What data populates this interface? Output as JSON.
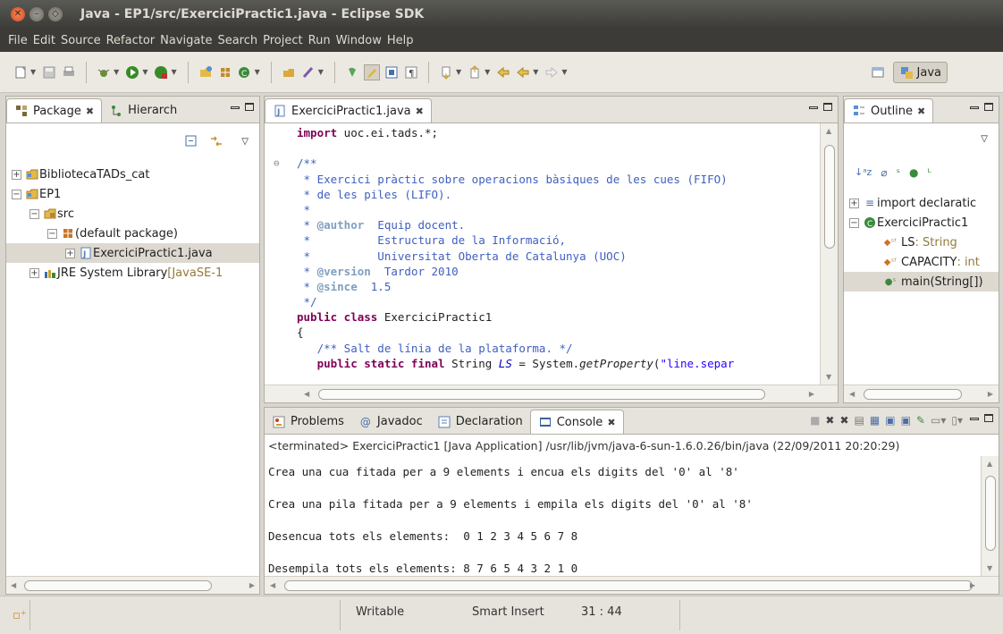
{
  "window": {
    "title": "Java - EP1/src/ExerciciPractic1.java - Eclipse SDK",
    "close_icon": "✕",
    "min_icon": "–",
    "max_icon": "◇"
  },
  "menu": [
    "File",
    "Edit",
    "Source",
    "Refactor",
    "Navigate",
    "Search",
    "Project",
    "Run",
    "Window",
    "Help"
  ],
  "perspective": {
    "label": "Java"
  },
  "package_explorer": {
    "tabs": [
      {
        "label": "Package"
      },
      {
        "label": "Hierarch"
      }
    ],
    "tree": [
      {
        "expander": "+",
        "label": "BibliotecaTADs_cat",
        "suffix": ""
      },
      {
        "expander": "−",
        "label": "EP1",
        "suffix": ""
      },
      {
        "expander": "−",
        "label": "src",
        "suffix": ""
      },
      {
        "expander": "−",
        "label": "(default package)",
        "suffix": ""
      },
      {
        "expander": "+",
        "label": "ExerciciPractic1.java",
        "suffix": ""
      },
      {
        "expander": "+",
        "label": "JRE System Library ",
        "suffix": "[JavaSE-1"
      }
    ]
  },
  "editor": {
    "tab_label": "ExerciciPractic1.java",
    "lines": {
      "l1_kw": "import",
      "l1_rest": " uoc.ei.tads.*;",
      "l3": "/**",
      "l4": " * Exercici pràctic sobre operacions bàsiques de les cues (FIFO)",
      "l5": " * de les piles (LIFO).",
      "l6": " *",
      "l7_pre": " * ",
      "l7_tag": "@author",
      "l7_rest": "  Equip docent.",
      "l8": " *          Estructura de la Informació,",
      "l9": " *          Universitat Oberta de Catalunya (UOC)",
      "l10_pre": " * ",
      "l10_tag": "@version",
      "l10_rest": "  Tardor 2010",
      "l11_pre": " * ",
      "l11_tag": "@since",
      "l11_rest": "  1.5",
      "l12": " */",
      "l13_kw": "public class",
      "l13_rest": " ExerciciPractic1",
      "l14": "{",
      "l15": "   /** Salt de línia de la plataforma. */",
      "l16_kw": "   public static final",
      "l16_a": " String ",
      "l16_field": "LS",
      "l16_b": " = System.",
      "l16_method": "getProperty",
      "l16_c": "(",
      "l16_str": "\"line.separ"
    }
  },
  "outline": {
    "tab_label": "Outline",
    "items": [
      {
        "expander": "+",
        "label": "import declaratic",
        "type": ""
      },
      {
        "expander": "−",
        "label": "ExerciciPractic1",
        "type": ""
      },
      {
        "expander": "",
        "label": "LS",
        "type": " : String"
      },
      {
        "expander": "",
        "label": "CAPACITY",
        "type": " : int"
      },
      {
        "expander": "",
        "label": "main(String[])",
        "type": ""
      }
    ]
  },
  "console": {
    "tabs": [
      {
        "label": "Problems"
      },
      {
        "label": "Javadoc"
      },
      {
        "label": "Declaration"
      },
      {
        "label": "Console"
      }
    ],
    "header": "<terminated> ExerciciPractic1 [Java Application] /usr/lib/jvm/java-6-sun-1.6.0.26/bin/java (22/09/2011 20:20:29)",
    "output": [
      "Crea una cua fitada per a 9 elements i encua els digits del '0' al '8'",
      "Crea una pila fitada per a 9 elements i empila els digits del '0' al '8'",
      "Desencua tots els elements:  0 1 2 3 4 5 6 7 8",
      "Desempila tots els elements: 8 7 6 5 4 3 2 1 0"
    ]
  },
  "status": {
    "writable": "Writable",
    "insert_mode": "Smart Insert",
    "position": "31 : 44"
  },
  "colors": {
    "keyword": "#7f0055",
    "javadoc": "#3f5fbf",
    "string": "#2a00ff"
  }
}
